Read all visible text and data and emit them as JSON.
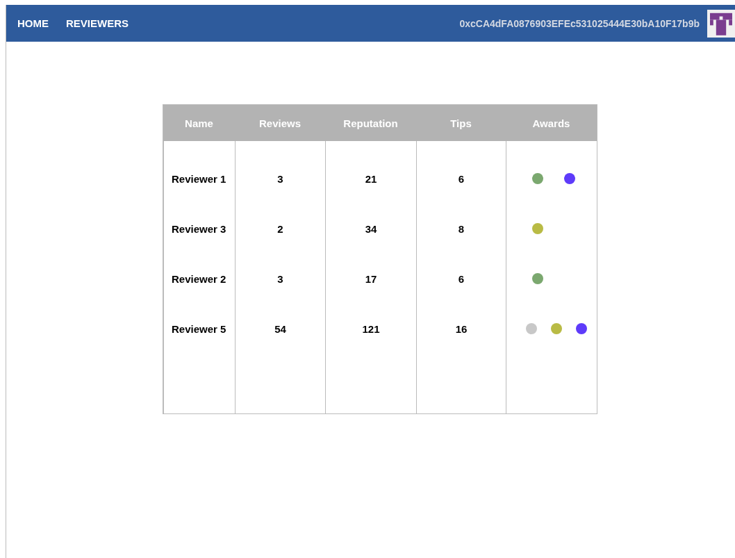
{
  "nav": {
    "links": [
      "HOME",
      "REVIEWERS"
    ],
    "account": "0xcCA4dFA0876903EFEc531025444E30bA10F17b9b"
  },
  "table": {
    "columns": [
      "Name",
      "Reviews",
      "Reputation",
      "Tips",
      "Awards"
    ],
    "rows": [
      {
        "name": "Reviewer 1",
        "reviews": "3",
        "reputation": "21",
        "tips": "6",
        "awards": [
          {
            "color": "#7ba86f"
          },
          {
            "color": "#5e3bfa"
          }
        ]
      },
      {
        "name": "Reviewer 3",
        "reviews": "2",
        "reputation": "34",
        "tips": "8",
        "awards": [
          {
            "color": "#b9bb45"
          }
        ]
      },
      {
        "name": "Reviewer 2",
        "reviews": "3",
        "reputation": "17",
        "tips": "6",
        "awards": [
          {
            "color": "#7ba86f"
          }
        ]
      },
      {
        "name": "Reviewer 5",
        "reviews": "54",
        "reputation": "121",
        "tips": "16",
        "awards": [
          {
            "color": "#c8c8c8"
          },
          {
            "color": "#b9bb45"
          },
          {
            "color": "#5e3bfa"
          }
        ]
      }
    ]
  }
}
